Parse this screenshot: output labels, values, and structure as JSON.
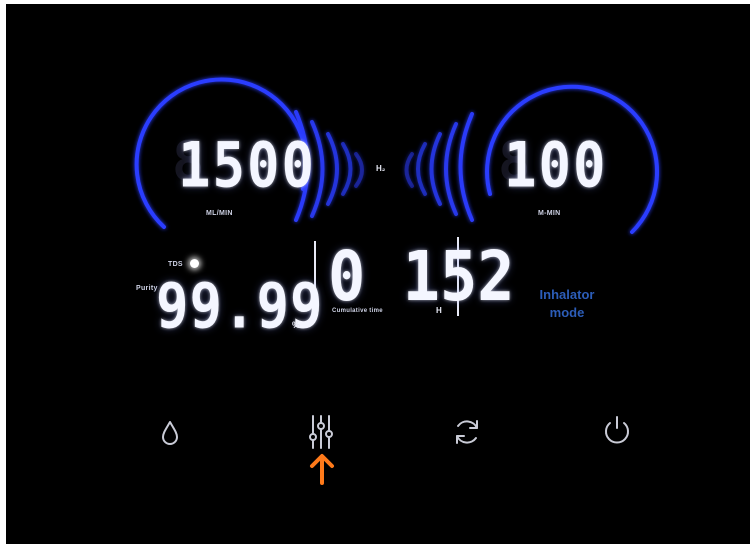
{
  "flow": {
    "value": "1500",
    "unit": "ML/MIN"
  },
  "time": {
    "value": "100",
    "unit": "M-MIN"
  },
  "gas": {
    "label": "H₂"
  },
  "purity": {
    "tds_label": "TDS",
    "label": "Purity",
    "value": "99.99",
    "unit": "%"
  },
  "cumulative": {
    "value": "0 152",
    "label": "Cumulative time",
    "unit": "H"
  },
  "mode": {
    "line1": "Inhalator",
    "line2": "mode"
  },
  "controls": [
    {
      "name": "water-drop-icon"
    },
    {
      "name": "settings-sliders-icon"
    },
    {
      "name": "refresh-icon"
    },
    {
      "name": "power-icon"
    }
  ],
  "colors": {
    "background": "#000000",
    "ring": "#2a3cff",
    "segment": "#f4f6ff",
    "mode_text": "#2c5db8",
    "pointer": "#ff7a1a",
    "icons": "#c9cbd6"
  }
}
